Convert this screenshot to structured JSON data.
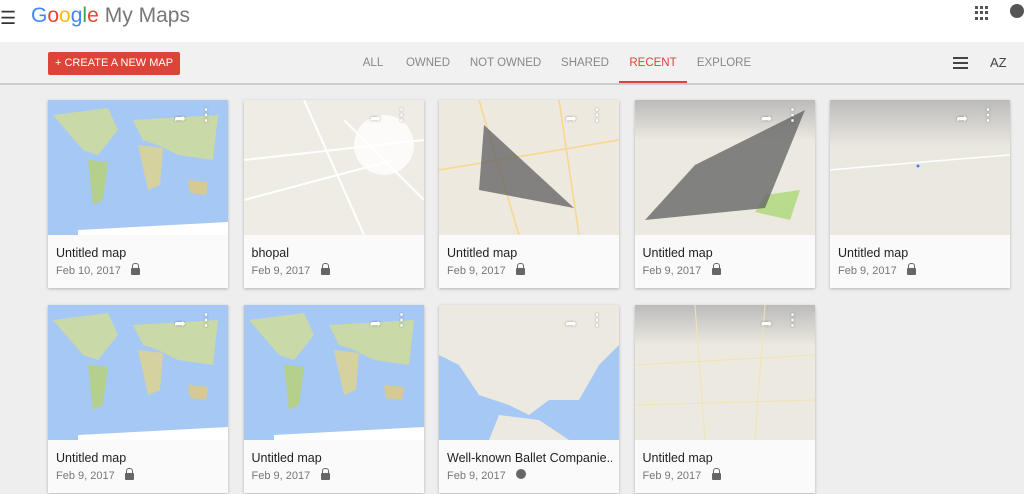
{
  "header": {
    "menu_icon": "hamburger-icon",
    "logo": "Google",
    "app_name": "My Maps",
    "apps_icon": "grid-apps-icon",
    "account_icon": "notifications-icon"
  },
  "toolbar": {
    "create_label": "+ CREATE A NEW MAP",
    "tabs": [
      {
        "label": "ALL"
      },
      {
        "label": "OWNED"
      },
      {
        "label": "NOT OWNED"
      },
      {
        "label": "SHARED"
      },
      {
        "label": "RECENT",
        "active": true
      },
      {
        "label": "EXPLORE"
      }
    ],
    "list_view_icon": "list-view-icon",
    "sort_icon": "sort-az-icon",
    "sort_label": "AZ",
    "accent": "#db4437"
  },
  "maps": [
    {
      "title": "Untitled map",
      "date": "Feb 10, 2017",
      "visibility": "private",
      "thumb": "world"
    },
    {
      "title": "bhopal",
      "date": "Feb 9, 2017",
      "visibility": "private",
      "thumb": "city"
    },
    {
      "title": "Untitled map",
      "date": "Feb 9, 2017",
      "visibility": "private",
      "thumb": "triangle"
    },
    {
      "title": "Untitled map",
      "date": "Feb 9, 2017",
      "visibility": "private",
      "thumb": "polygon"
    },
    {
      "title": "Untitled map",
      "date": "Feb 9, 2017",
      "visibility": "private",
      "thumb": "plain"
    },
    {
      "title": "Untitled map",
      "date": "Feb 9, 2017",
      "visibility": "private",
      "thumb": "world"
    },
    {
      "title": "Untitled map",
      "date": "Feb 9, 2017",
      "visibility": "private",
      "thumb": "world"
    },
    {
      "title": "Well-known Ballet Companie..",
      "date": "Feb 9, 2017",
      "visibility": "public",
      "thumb": "usa"
    },
    {
      "title": "Untitled map",
      "date": "Feb 9, 2017",
      "visibility": "private",
      "thumb": "terrain"
    }
  ]
}
